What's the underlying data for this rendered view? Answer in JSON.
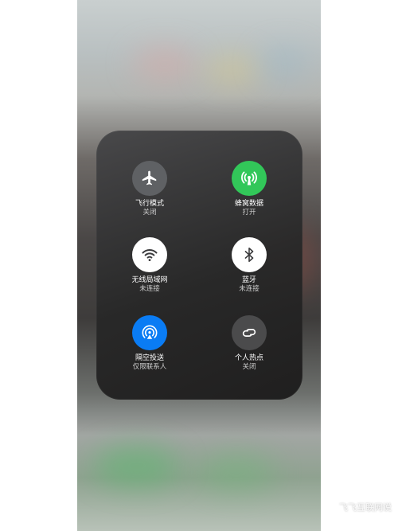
{
  "controls": [
    {
      "label": "飞行模式",
      "status": "关闭",
      "icon": "airplane-icon",
      "color": "#5f6164"
    },
    {
      "label": "蜂窝数据",
      "status": "打开",
      "icon": "cellular-antenna-icon",
      "color": "#32c759"
    },
    {
      "label": "无线局域网",
      "status": "未连接",
      "icon": "wifi-icon",
      "color": "#ffffff"
    },
    {
      "label": "蓝牙",
      "status": "未连接",
      "icon": "bluetooth-icon",
      "color": "#ffffff"
    },
    {
      "label": "隔空投送",
      "status": "仅限联系人",
      "icon": "airdrop-icon",
      "color": "#0a7cf4"
    },
    {
      "label": "个人热点",
      "status": "关闭",
      "icon": "hotspot-link-icon",
      "color": "#4b4b4c"
    }
  ],
  "watermark": {
    "text": "飞飞互联网说",
    "icon": "paw-icon"
  }
}
